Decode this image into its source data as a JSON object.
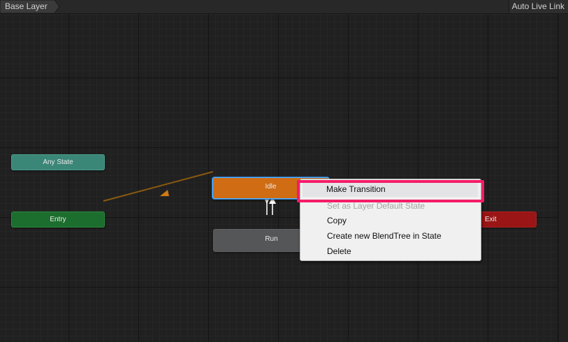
{
  "toolbar": {
    "breadcrumb": "Base Layer",
    "live_link": "Auto Live Link"
  },
  "nodes": {
    "any_state": "Any State",
    "entry": "Entry",
    "idle": "Idle",
    "run": "Run",
    "exit": "Exit"
  },
  "context_menu": {
    "items": [
      {
        "label": "Make Transition",
        "enabled": true,
        "highlighted": true
      },
      {
        "label": "Set as Layer Default State",
        "enabled": false
      },
      {
        "label": "Copy",
        "enabled": true
      },
      {
        "label": "Create new BlendTree in State",
        "enabled": true
      },
      {
        "label": "Delete",
        "enabled": true
      }
    ]
  },
  "colors": {
    "accent_highlight": "#f51c67",
    "default_state": "#cf6c14",
    "entry": "#1c6e2e",
    "any_state": "#3a8677",
    "exit": "#9a1515",
    "state": "#555657"
  }
}
